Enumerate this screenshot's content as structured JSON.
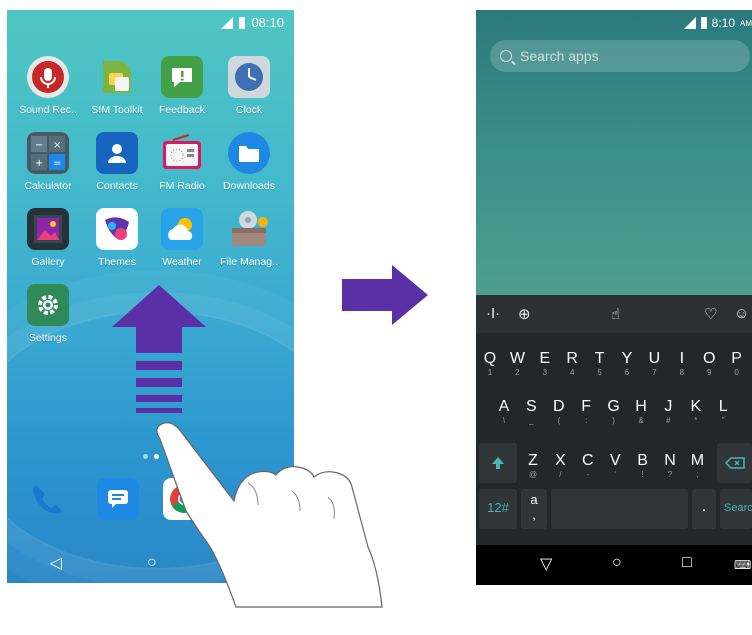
{
  "left_phone": {
    "status_time": "08:10",
    "apps": [
      {
        "label": "Sound Rec..",
        "icon": "microphone-icon"
      },
      {
        "label": "SIM Toolkit",
        "icon": "sim-card-icon"
      },
      {
        "label": "Feedback",
        "icon": "feedback-icon"
      },
      {
        "label": "Clock",
        "icon": "clock-icon"
      },
      {
        "label": "Calculator",
        "icon": "calculator-icon"
      },
      {
        "label": "Contacts",
        "icon": "contacts-icon"
      },
      {
        "label": "FM Radio",
        "icon": "radio-icon"
      },
      {
        "label": "Downloads",
        "icon": "folder-icon"
      },
      {
        "label": "Gallery",
        "icon": "gallery-icon"
      },
      {
        "label": "Themes",
        "icon": "themes-icon"
      },
      {
        "label": "Weather",
        "icon": "weather-icon"
      },
      {
        "label": "File Manag..",
        "icon": "file-manager-icon"
      },
      {
        "label": "Settings",
        "icon": "gear-icon"
      }
    ],
    "dock": [
      "phone-icon",
      "messages-icon",
      "chrome-icon",
      "camera-icon"
    ],
    "nav": {
      "back": "◁",
      "home": "○",
      "recents": "□"
    }
  },
  "right_phone": {
    "status_time": "8:10",
    "status_ampm": "AM",
    "search_placeholder": "Search apps",
    "keyboard": {
      "row1": [
        {
          "k": "Q",
          "s": "1"
        },
        {
          "k": "W",
          "s": "2"
        },
        {
          "k": "E",
          "s": "3"
        },
        {
          "k": "R",
          "s": "4"
        },
        {
          "k": "T",
          "s": "5"
        },
        {
          "k": "Y",
          "s": "6"
        },
        {
          "k": "U",
          "s": "7"
        },
        {
          "k": "I",
          "s": "8"
        },
        {
          "k": "O",
          "s": "9"
        },
        {
          "k": "P",
          "s": "0"
        }
      ],
      "row2": [
        {
          "k": "A",
          "s": "\\"
        },
        {
          "k": "S",
          "s": "_"
        },
        {
          "k": "D",
          "s": "("
        },
        {
          "k": "F",
          "s": ":"
        },
        {
          "k": "G",
          "s": ")"
        },
        {
          "k": "H",
          "s": "&"
        },
        {
          "k": "J",
          "s": "#"
        },
        {
          "k": "K",
          "s": "*"
        },
        {
          "k": "L",
          "s": "\""
        }
      ],
      "row3": [
        {
          "k": "Z",
          "s": "@"
        },
        {
          "k": "X",
          "s": "/"
        },
        {
          "k": "C",
          "s": "-"
        },
        {
          "k": "V",
          "s": "'"
        },
        {
          "k": "B",
          "s": "!"
        },
        {
          "k": "N",
          "s": "?"
        },
        {
          "k": "M",
          "s": ";"
        }
      ],
      "sym_key": "12#",
      "lang_key": "a",
      "period_key": ".",
      "search_key": "Search"
    },
    "nav": {
      "back": "▽",
      "home": "○",
      "recents": "□"
    }
  }
}
